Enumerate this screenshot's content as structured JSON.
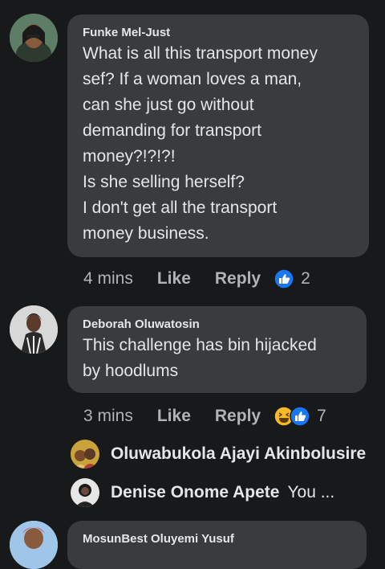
{
  "comments": [
    {
      "author": "Funke Mel-Just",
      "lines": [
        "What is all this transport money",
        "sef? If a woman loves a man,",
        "can she just go without",
        "demanding for transport",
        "money?!?!?!",
        "Is she selling herself?",
        "I don't get all the transport",
        "money business."
      ],
      "time": "4 mins",
      "like_label": "Like",
      "reply_label": "Reply",
      "reaction_count": "2",
      "reactions": [
        "like-reaction-icon"
      ]
    },
    {
      "author": "Deborah Oluwatosin",
      "lines": [
        "This challenge has bin hijacked",
        "by hoodlums"
      ],
      "time": "3 mins",
      "like_label": "Like",
      "reply_label": "Reply",
      "reaction_count": "7",
      "reactions": [
        "haha-reaction-icon",
        "like-reaction-icon"
      ]
    }
  ],
  "replies": [
    {
      "name": "Oluwabukola Ajayi Akinbolusire",
      "snippet": ""
    },
    {
      "name": "Denise Onome Apete",
      "snippet": "You ..."
    }
  ],
  "next_comment": {
    "author": "MosunBest Oluyemi Yusuf"
  },
  "colors": {
    "background": "#18191a",
    "bubble": "#3a3b3c",
    "text": "#e4e6eb",
    "secondary": "#b0b3b8",
    "like_blue": "#1877f2",
    "haha_yellow": "#f7b928"
  }
}
